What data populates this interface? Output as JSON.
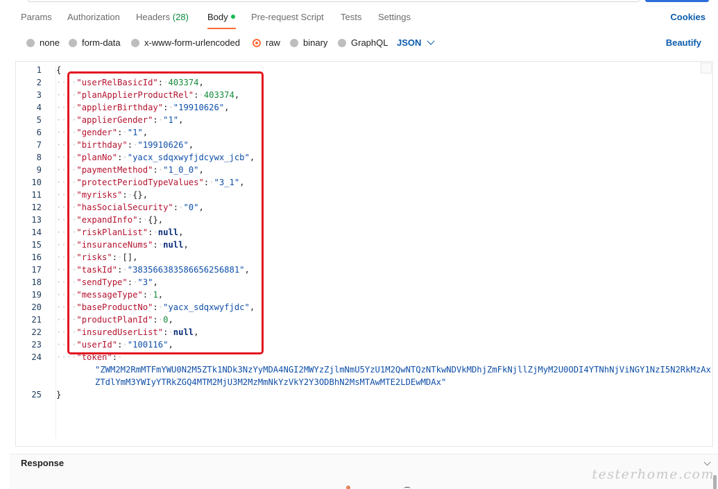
{
  "tabs": [
    {
      "label": "Params",
      "active": false
    },
    {
      "label": "Authorization",
      "active": false
    },
    {
      "label": "Headers",
      "count": "(28)",
      "active": false
    },
    {
      "label": "Body",
      "active": true
    },
    {
      "label": "Pre-request Script",
      "active": false
    },
    {
      "label": "Tests",
      "active": false
    },
    {
      "label": "Settings",
      "active": false
    }
  ],
  "cookies_label": "Cookies",
  "body_types": [
    {
      "label": "none",
      "selected": false
    },
    {
      "label": "form-data",
      "selected": false
    },
    {
      "label": "x-www-form-urlencoded",
      "selected": false
    },
    {
      "label": "raw",
      "selected": true
    },
    {
      "label": "binary",
      "selected": false
    },
    {
      "label": "GraphQL",
      "selected": false
    }
  ],
  "language": "JSON",
  "beautify_label": "Beautify",
  "editor": {
    "lines": [
      {
        "n": "1",
        "text": "{"
      },
      {
        "n": "2",
        "key": "userRelBasicId",
        "val": "403374",
        "type": "num"
      },
      {
        "n": "3",
        "key": "planApplierProductRel",
        "val": "403374",
        "type": "num"
      },
      {
        "n": "4",
        "key": "applierBirthday",
        "val": "\"19910626\"",
        "type": "str"
      },
      {
        "n": "5",
        "key": "applierGender",
        "val": "\"1\"",
        "type": "str"
      },
      {
        "n": "6",
        "key": "gender",
        "val": "\"1\"",
        "type": "str"
      },
      {
        "n": "7",
        "key": "birthday",
        "val": "\"19910626\"",
        "type": "str"
      },
      {
        "n": "8",
        "key": "planNo",
        "val": "\"yacx_sdqxwyfjdcywx_jcb\"",
        "type": "str"
      },
      {
        "n": "9",
        "key": "paymentMethod",
        "val": "\"1_0_0\"",
        "type": "str"
      },
      {
        "n": "10",
        "key": "protectPeriodTypeValues",
        "val": "\"3_1\"",
        "type": "str"
      },
      {
        "n": "11",
        "key": "myrisks",
        "val": "{}",
        "type": "punc"
      },
      {
        "n": "12",
        "key": "hasSocialSecurity",
        "val": "\"0\"",
        "type": "str"
      },
      {
        "n": "13",
        "key": "expandInfo",
        "val": "{}",
        "type": "punc"
      },
      {
        "n": "14",
        "key": "riskPlanList",
        "val": "null",
        "type": "kw"
      },
      {
        "n": "15",
        "key": "insuranceNums",
        "val": "null",
        "type": "kw"
      },
      {
        "n": "16",
        "key": "risks",
        "val": "[]",
        "type": "punc"
      },
      {
        "n": "17",
        "key": "taskId",
        "val": "\"383566383586656256881\"",
        "type": "str"
      },
      {
        "n": "18",
        "key": "sendType",
        "val": "\"3\"",
        "type": "str"
      },
      {
        "n": "19",
        "key": "messageType",
        "val": "1",
        "type": "num"
      },
      {
        "n": "20",
        "key": "baseProductNo",
        "val": "\"yacx_sdqxwyfjdc\"",
        "type": "str"
      },
      {
        "n": "21",
        "key": "productPlanId",
        "val": "0",
        "type": "num"
      },
      {
        "n": "22",
        "key": "insuredUserList",
        "val": "null",
        "type": "kw"
      },
      {
        "n": "23",
        "key": "userId",
        "val": "\"100116\"",
        "type": "str"
      },
      {
        "n": "24",
        "key": "token",
        "val_lines": [
          "\"ZWM2M2RmMTFmYWU0N2M5ZTk1NDk3NzYyMDA4NGI2MWYzZjlmNmU5YzU1M2QwNTQzNTkwNDVkMDhjZmFkNjllZjMyM2U0ODI4YTNhNjViNGY1NzI5N2RkMzAx",
          "ZTdlYmM3YWIyYTRkZGQ4MTM2MjU3M2MzMmNkYzVkY2Y3ODBhN2MsMTAwMTE2LDEwMDAx\""
        ],
        "type": "str"
      },
      {
        "n": "25",
        "text": "}"
      }
    ]
  },
  "response_label": "Response",
  "watermark": "testerhome.com"
}
